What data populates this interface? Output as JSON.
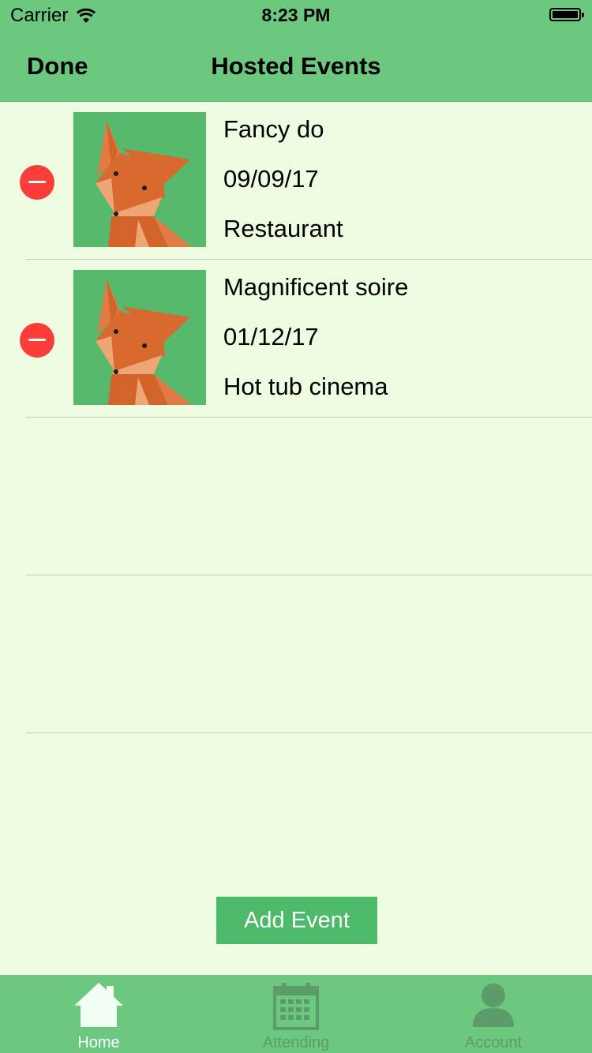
{
  "status_bar": {
    "carrier": "Carrier",
    "time": "8:23 PM"
  },
  "nav": {
    "left_button": "Done",
    "title": "Hosted Events"
  },
  "events": [
    {
      "name": "Fancy do",
      "date": "09/09/17",
      "place": "Restaurant",
      "thumbnail": "fox-image"
    },
    {
      "name": "Magnificent soire",
      "date": "01/12/17",
      "place": "Hot tub cinema",
      "thumbnail": "fox-image"
    }
  ],
  "add_button": "Add Event",
  "tabs": [
    {
      "label": "Home",
      "icon": "home-icon",
      "selected": true
    },
    {
      "label": "Attending",
      "icon": "calendar-icon",
      "selected": false
    },
    {
      "label": "Account",
      "icon": "person-icon",
      "selected": false
    }
  ],
  "colors": {
    "bar_green": "#6CC77F",
    "background": "#EEFCE2",
    "button_green": "#4CBA69",
    "delete_red": "#FC3D39",
    "inactive_tab": "#5C9B6A"
  }
}
